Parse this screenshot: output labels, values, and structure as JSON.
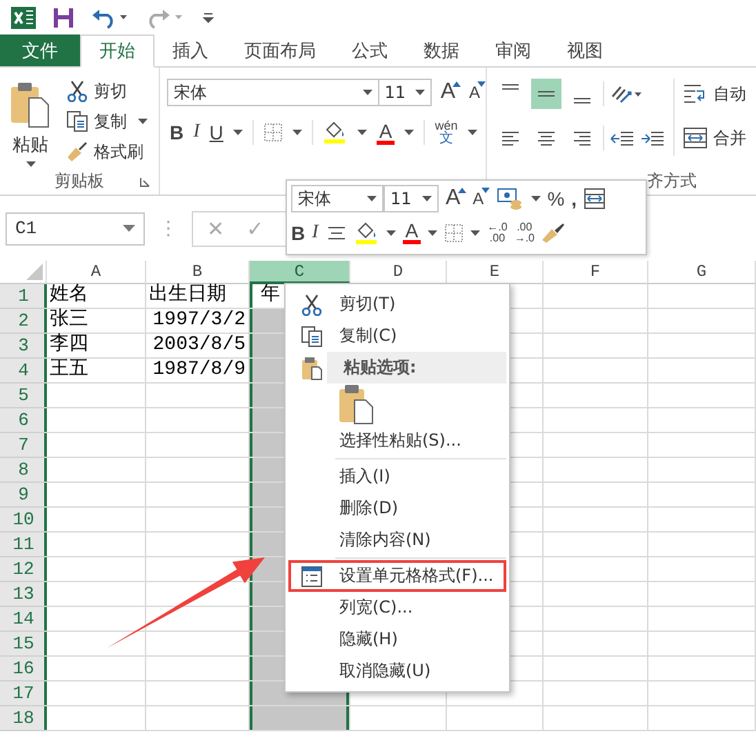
{
  "quick_access": {
    "undo_enabled": true,
    "redo_enabled": false
  },
  "tabs": [
    {
      "label": "文件",
      "kind": "file",
      "selected": false
    },
    {
      "label": "开始",
      "kind": "tab",
      "selected": true
    },
    {
      "label": "插入",
      "kind": "tab",
      "selected": false
    },
    {
      "label": "页面布局",
      "kind": "tab",
      "selected": false
    },
    {
      "label": "公式",
      "kind": "tab",
      "selected": false
    },
    {
      "label": "数据",
      "kind": "tab",
      "selected": false
    },
    {
      "label": "审阅",
      "kind": "tab",
      "selected": false
    },
    {
      "label": "视图",
      "kind": "tab",
      "selected": false
    }
  ],
  "ribbon": {
    "clipboard": {
      "paste": "粘贴",
      "cut": "剪切",
      "copy": "复制",
      "painter": "格式刷",
      "label": "剪贴板"
    },
    "font": {
      "name": "宋体",
      "size": "11",
      "grow": "A",
      "shrink": "A",
      "bold": "B",
      "italic": "I",
      "underline": "U",
      "font_color": "A",
      "phonetic": "wén",
      "phonetic_char": "文"
    },
    "alignment": {
      "vertical": [
        {
          "kind": "top",
          "selected": false
        },
        {
          "kind": "middle",
          "selected": true
        },
        {
          "kind": "bottom",
          "selected": false
        }
      ],
      "horizontal": [
        {
          "kind": "left",
          "selected": false
        },
        {
          "kind": "center",
          "selected": false
        },
        {
          "kind": "right",
          "selected": false
        }
      ],
      "wrap": "自动",
      "merge": "合并",
      "label": "齐方式"
    }
  },
  "formula_bar": {
    "name_box": "C1",
    "separator": "⋮",
    "cancel": "✕",
    "enter": "✓"
  },
  "sheet": {
    "columns": [
      {
        "label": "A",
        "selected": false
      },
      {
        "label": "B",
        "selected": false
      },
      {
        "label": "C",
        "selected": true
      },
      {
        "label": "D",
        "selected": false
      },
      {
        "label": "E",
        "selected": false
      },
      {
        "label": "F",
        "selected": false
      },
      {
        "label": "G",
        "selected": false
      }
    ],
    "rows": [
      {
        "label": "1",
        "cells": [
          {
            "text": "姓名",
            "kind": "text"
          },
          {
            "text": "出生日期",
            "kind": "text"
          },
          {
            "text": "年",
            "kind": "text",
            "active": true
          }
        ]
      },
      {
        "label": "2",
        "cells": [
          {
            "text": "张三",
            "kind": "text"
          },
          {
            "text": "1997/3/2",
            "kind": "number"
          }
        ]
      },
      {
        "label": "3",
        "cells": [
          {
            "text": "李四",
            "kind": "text"
          },
          {
            "text": "2003/8/5",
            "kind": "number"
          }
        ]
      },
      {
        "label": "4",
        "cells": [
          {
            "text": "王五",
            "kind": "text"
          },
          {
            "text": "1987/8/9",
            "kind": "number"
          }
        ]
      },
      {
        "label": "5"
      },
      {
        "label": "6"
      },
      {
        "label": "7"
      },
      {
        "label": "8"
      },
      {
        "label": "9"
      },
      {
        "label": "10"
      },
      {
        "label": "11"
      },
      {
        "label": "12"
      },
      {
        "label": "13"
      },
      {
        "label": "14"
      },
      {
        "label": "15"
      },
      {
        "label": "16"
      },
      {
        "label": "17"
      },
      {
        "label": "18"
      }
    ]
  },
  "mini_toolbar": {
    "font": "宋体",
    "size": "11",
    "grow": "A",
    "shrink": "A",
    "percent": "%",
    "comma": ",",
    "bold": "B",
    "italic": "I",
    "font_color": "A",
    "increase_decimal": [
      "←.0",
      ".00"
    ],
    "decrease_decimal": [
      ".00",
      "→.0"
    ]
  },
  "context_menu": [
    {
      "kind": "cut",
      "label": "剪切(T)",
      "annotated": false
    },
    {
      "kind": "copy",
      "label": "复制(C)",
      "annotated": false
    },
    {
      "kind": "paste_header",
      "label": "粘贴选项:"
    },
    {
      "kind": "paste_button"
    },
    {
      "kind": "plain",
      "label": "选择性粘贴(S)...",
      "annotated": false
    },
    {
      "kind": "separator"
    },
    {
      "kind": "plain",
      "label": "插入(I)",
      "annotated": false
    },
    {
      "kind": "plain",
      "label": "删除(D)",
      "annotated": false
    },
    {
      "kind": "plain",
      "label": "清除内容(N)",
      "annotated": false
    },
    {
      "kind": "separator"
    },
    {
      "kind": "format_cells",
      "label": "设置单元格格式(F)...",
      "annotated": true
    },
    {
      "kind": "plain",
      "label": "列宽(C)...",
      "annotated": false
    },
    {
      "kind": "plain",
      "label": "隐藏(H)",
      "annotated": false
    },
    {
      "kind": "plain",
      "label": "取消隐藏(U)",
      "annotated": false
    }
  ]
}
